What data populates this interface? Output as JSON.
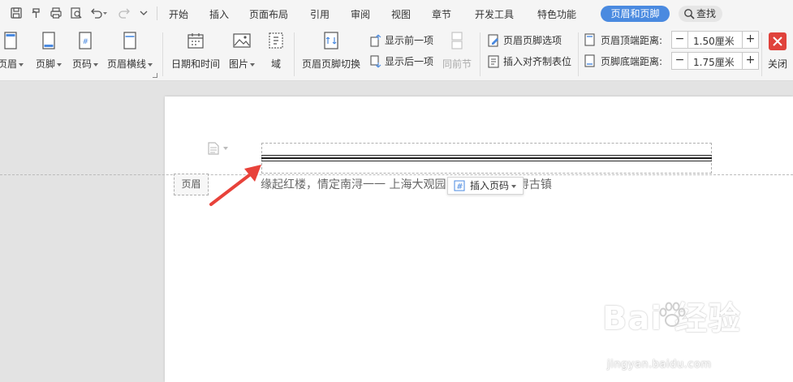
{
  "menu": {
    "tabs": [
      "开始",
      "插入",
      "页面布局",
      "引用",
      "审阅",
      "视图",
      "章节",
      "开发工具",
      "特色功能"
    ],
    "active_tab": "页眉和页脚",
    "find_label": "查找"
  },
  "ribbon": {
    "header_label": "页眉",
    "footer_label": "页脚",
    "page_number_label": "页码",
    "header_line_label": "页眉横线",
    "datetime_label": "日期和时间",
    "picture_label": "图片",
    "field_label": "域",
    "switch_label": "页眉页脚切换",
    "show_prev_label": "显示前一项",
    "show_next_label": "显示后一项",
    "same_as_prev_label": "同前节",
    "options_label": "页眉页脚选项",
    "insert_align_tab_label": "插入对齐制表位",
    "header_top_distance_label": "页眉顶端距离:",
    "header_top_distance_value": "1.50厘米",
    "footer_bottom_distance_label": "页脚底端距离:",
    "footer_bottom_distance_value": "1.75厘米",
    "close_label": "关闭"
  },
  "document": {
    "header_tag": "页眉",
    "header_text": "缘起红楼，情定南浔一一 上海大观园 ",
    "header_text_tail": "南浔古镇",
    "insert_page_number_label": "插入页码"
  },
  "watermark": {
    "logo": "Bai  经验",
    "url": "jingyan.baidu.com"
  },
  "colors": {
    "active_tab": "#4a8ae0",
    "close_red": "#e0423b",
    "arrow_red": "#e8423a"
  }
}
